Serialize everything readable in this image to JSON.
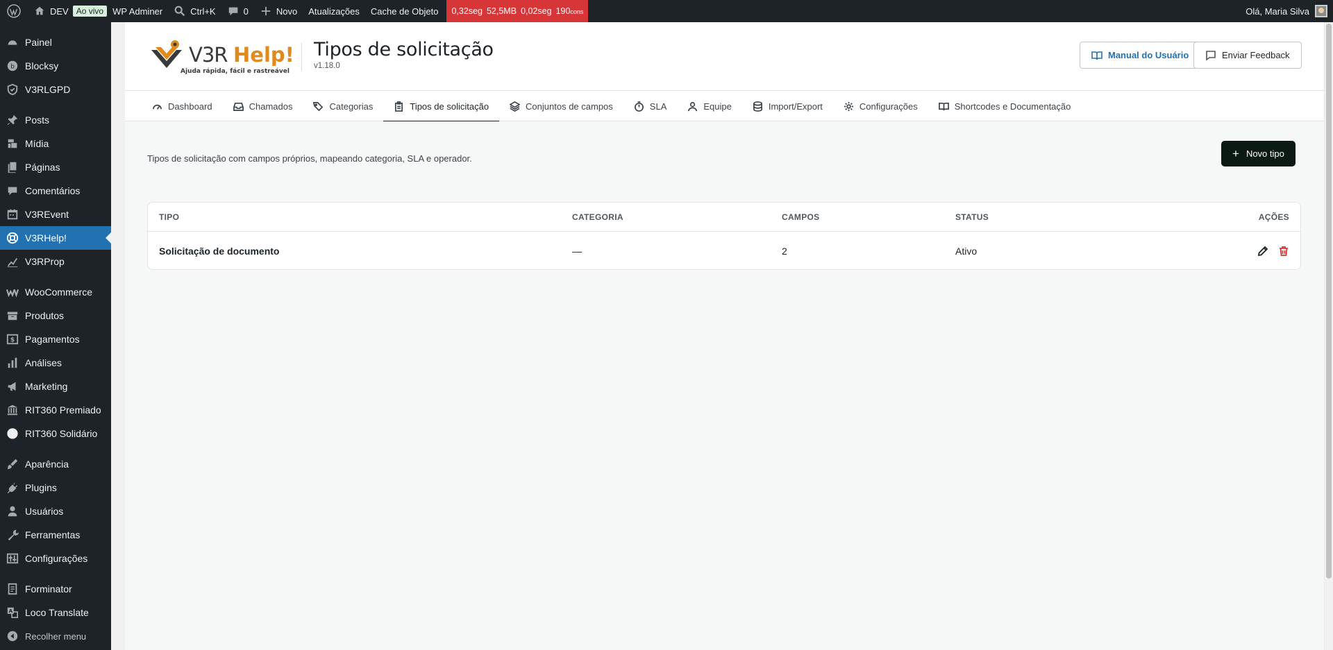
{
  "adminbar": {
    "site_name": "DEV",
    "live_badge": "Ao vivo",
    "wp_adminer": "WP Adminer",
    "search_shortcut": "Ctrl+K",
    "comments_count": "0",
    "new_label": "Novo",
    "updates": "Atualizações",
    "object_cache": "Cache de Objeto",
    "perf": {
      "time": "0,32seg",
      "memory": "52,5MB",
      "query_time": "0,02seg",
      "queries": "190",
      "queries_unit": "cons"
    },
    "greeting": "Olá, Maria Silva"
  },
  "sidebar": {
    "items": [
      {
        "label": "Painel",
        "icon": "dashboard-icon"
      },
      {
        "label": "Blocksy",
        "icon": "blocksy-icon"
      },
      {
        "label": "V3RLGPD",
        "icon": "shield-icon"
      },
      {
        "label": "Posts",
        "icon": "pin-icon"
      },
      {
        "label": "Mídia",
        "icon": "media-icon"
      },
      {
        "label": "Páginas",
        "icon": "pages-icon"
      },
      {
        "label": "Comentários",
        "icon": "comment-icon"
      },
      {
        "label": "V3REvent",
        "icon": "calendar-icon"
      },
      {
        "label": "V3RHelp!",
        "icon": "lifebuoy-icon"
      },
      {
        "label": "V3RProp",
        "icon": "chart-line-icon"
      },
      {
        "label": "WooCommerce",
        "icon": "woo-icon"
      },
      {
        "label": "Produtos",
        "icon": "archive-icon"
      },
      {
        "label": "Pagamentos",
        "icon": "money-icon"
      },
      {
        "label": "Análises",
        "icon": "bar-chart-icon"
      },
      {
        "label": "Marketing",
        "icon": "megaphone-icon"
      },
      {
        "label": "RIT360 Premiado",
        "icon": "building-icon"
      },
      {
        "label": "RIT360 Solidário",
        "icon": "circle-icon"
      },
      {
        "label": "Aparência",
        "icon": "brush-icon"
      },
      {
        "label": "Plugins",
        "icon": "plugin-icon"
      },
      {
        "label": "Usuários",
        "icon": "user-icon"
      },
      {
        "label": "Ferramentas",
        "icon": "wrench-icon"
      },
      {
        "label": "Configurações",
        "icon": "settings-icon"
      },
      {
        "label": "Forminator",
        "icon": "form-icon"
      },
      {
        "label": "Loco Translate",
        "icon": "translate-icon"
      }
    ],
    "collapse_label": "Recolher menu"
  },
  "header": {
    "logo_text": "V3RHelp!",
    "logo_tagline": "Ajuda rápida, fácil e rastreável",
    "title": "Tipos de solicitação",
    "version": "v1.18.0",
    "manual_button": "Manual do Usuário",
    "feedback_button": "Enviar Feedback"
  },
  "tabs": [
    {
      "label": "Dashboard"
    },
    {
      "label": "Chamados"
    },
    {
      "label": "Categorias"
    },
    {
      "label": "Tipos de solicitação"
    },
    {
      "label": "Conjuntos de campos"
    },
    {
      "label": "SLA"
    },
    {
      "label": "Equipe"
    },
    {
      "label": "Import/Export"
    },
    {
      "label": "Configurações"
    },
    {
      "label": "Shortcodes e Documentação"
    }
  ],
  "main": {
    "description": "Tipos de solicitação com campos próprios, mapeando categoria, SLA e operador.",
    "new_button": "Novo tipo",
    "table": {
      "headers": [
        "TIPO",
        "CATEGORIA",
        "CAMPOS",
        "STATUS",
        "AÇÕES"
      ],
      "rows": [
        {
          "tipo": "Solicitação de documento",
          "categoria": "—",
          "campos": "2",
          "status": "Ativo"
        }
      ]
    }
  },
  "colors": {
    "admin_bg": "#1d2327",
    "active_menu": "#2271b1",
    "perf_bar": "#d63638",
    "brand_orange": "#e08a1e",
    "new_button_bg": "#0b1a13"
  }
}
